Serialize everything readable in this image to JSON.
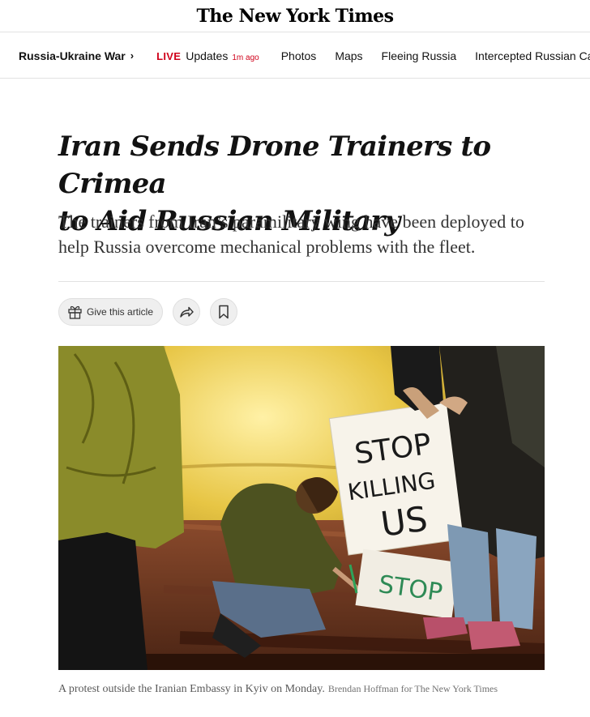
{
  "masthead": {
    "logo": "The New York Times"
  },
  "subnav": {
    "section": "Russia-Ukraine War",
    "live_label": "LIVE",
    "updates_label": "Updates",
    "updated_ago": "1m ago",
    "links": [
      "Photos",
      "Maps",
      "Fleeing Russia",
      "Intercepted Russian Calls"
    ]
  },
  "article": {
    "headline_line1": "Iran Sends Drone Trainers to Crimea",
    "headline_line2": "to Aid Russian Military",
    "summary": "The trainers from Iran’s paramilitary wing have been deployed to help Russia overcome mechanical problems with the fleet.",
    "actions": {
      "gift_label": "Give this article"
    },
    "sign_text": {
      "line1": "STOP",
      "line2": "KILLING",
      "line3": "US",
      "hashtag": "#",
      "ground_sign": "STOP"
    },
    "caption": "A protest outside the Iranian Embassy in Kyiv on Monday.",
    "credit": "Brendan Hoffman for The New York Times"
  },
  "colors": {
    "live_red": "#d0021b",
    "text": "#121212",
    "rule": "#e2e2e2"
  },
  "icons": [
    "chevron-right-icon",
    "gift-icon",
    "share-icon",
    "bookmark-icon"
  ]
}
